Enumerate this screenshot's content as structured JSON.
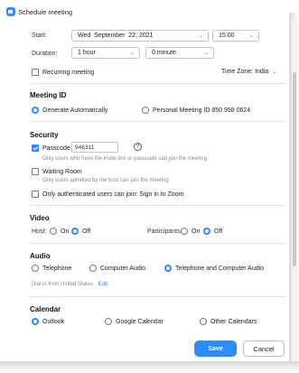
{
  "window": {
    "title": "Schedule meeting"
  },
  "start": {
    "label": "Start:",
    "date": "Wed  September  22, 2021",
    "time": "15:00"
  },
  "duration": {
    "label": "Duration:",
    "hours": "1 hour",
    "minutes": "0 minute"
  },
  "recurring": {
    "label": "Recurring meeting",
    "checked": false
  },
  "timezone": {
    "label": "Time Zone: India"
  },
  "meeting_id": {
    "heading": "Meeting ID",
    "option_auto": "Generate Automatically",
    "option_personal": "Personal Meeting ID 850 958 0624",
    "selected": "auto"
  },
  "security": {
    "heading": "Security",
    "passcode_label": "Passcode",
    "passcode_value": "946311",
    "passcode_hint": "Only users who have the invite link or passcode can join the meeting",
    "waiting_label": "Waiting Room",
    "waiting_hint": "Only users admitted by the host can join the meeting",
    "auth_label": "Only authenticated users can join: Sign in to Zoom",
    "help_glyph": "?"
  },
  "video": {
    "heading": "Video",
    "host_label": "Host:",
    "participants_label": "Participants:",
    "on": "On",
    "off": "Off"
  },
  "audio": {
    "heading": "Audio",
    "telephone": "Telephone",
    "computer": "Computer Audio",
    "both": "Telephone and Computer Audio",
    "dial_text": "Dial in from United States",
    "edit": "Edit"
  },
  "calendar": {
    "heading": "Calendar",
    "outlook": "Outlook",
    "google": "Google Calendar",
    "other": "Other Calendars"
  },
  "buttons": {
    "save": "Save",
    "cancel": "Cancel"
  },
  "icons": {
    "chevron": "chevron-down-icon",
    "accent": "#2d8cff"
  }
}
